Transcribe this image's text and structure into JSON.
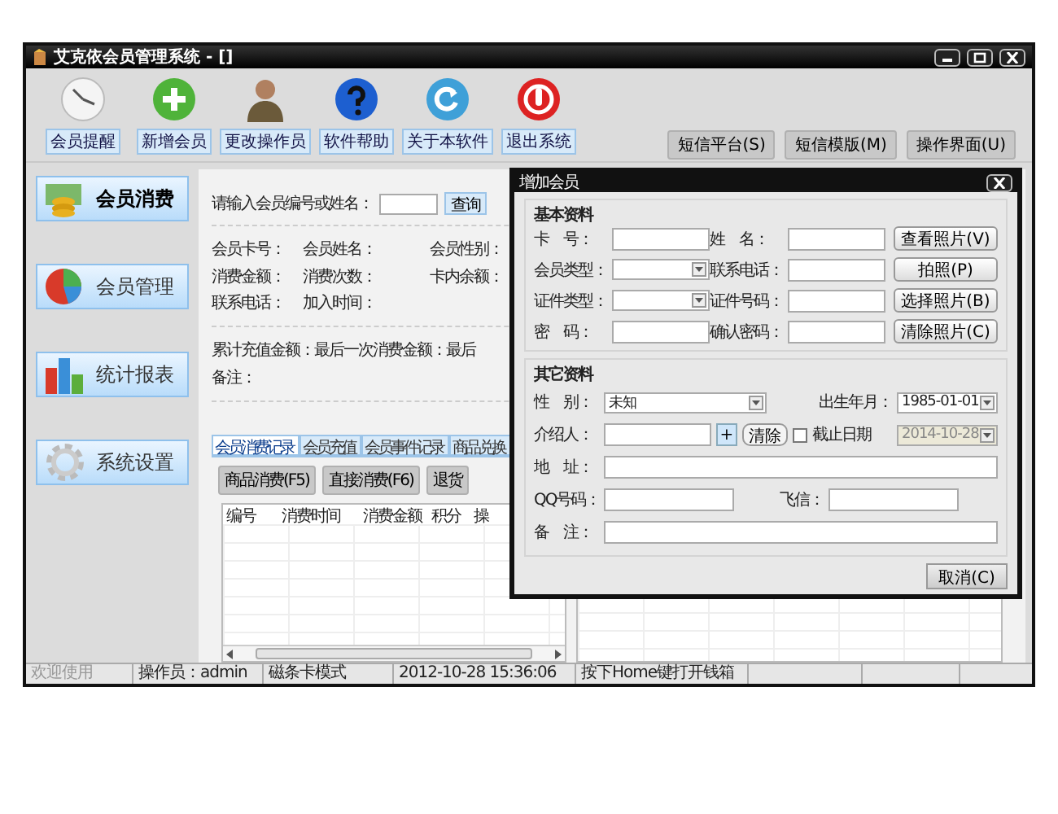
{
  "window": {
    "title": "艾克依会员管理系统 - []"
  },
  "toolbar": [
    {
      "label": "会员提醒",
      "kind": "clock"
    },
    {
      "label": "新增会员",
      "kind": "plus"
    },
    {
      "label": "更改操作员",
      "kind": "person"
    },
    {
      "label": "软件帮助",
      "kind": "help"
    },
    {
      "label": "关于本软件",
      "kind": "refresh"
    },
    {
      "label": "退出系统",
      "kind": "power"
    }
  ],
  "toolbar_buttons": [
    "短信平台(S)",
    "短信模版(M)",
    "操作界面(U)"
  ],
  "sidebar": [
    {
      "label": "会员消费",
      "selected": true,
      "kind": "coins"
    },
    {
      "label": "会员管理",
      "selected": false,
      "kind": "pie"
    },
    {
      "label": "统计报表",
      "selected": false,
      "kind": "bars"
    },
    {
      "label": "系统设置",
      "selected": false,
      "kind": "gear"
    }
  ],
  "search": {
    "label": "请输入会员编号或姓名：",
    "button": "查询"
  },
  "info_rows": [
    [
      "会员卡号：",
      "会员姓名：",
      "会员性别："
    ],
    [
      "消费金额：",
      "消费次数：",
      "卡内余额："
    ],
    [
      "联系电话：",
      "加入时间："
    ],
    [
      "累计充值金额：",
      "最后一次消费金额：",
      "最后"
    ],
    [
      "备注："
    ]
  ],
  "tabs": [
    {
      "label": "会员消费记录",
      "selected": true
    },
    {
      "label": "会员充值",
      "selected": false
    },
    {
      "label": "会员事件记录",
      "selected": false
    },
    {
      "label": "商品兑换",
      "selected": false
    }
  ],
  "action_buttons": [
    "商品消费(F5)",
    "直接消费(F6)",
    "退货"
  ],
  "table": {
    "columns": [
      "编号",
      "消费时间",
      "消费金额",
      "积分",
      "操"
    ]
  },
  "status_bar": [
    {
      "text": "欢迎使用",
      "disabled": true
    },
    {
      "text": "操作员：admin",
      "disabled": false
    },
    {
      "text": "磁条卡模式",
      "disabled": false
    },
    {
      "text": "2012-10-28 15:36:06",
      "disabled": false
    },
    {
      "text": "按下Home键打开钱箱",
      "disabled": false
    }
  ],
  "dialog": {
    "title": "增加会员",
    "basic": {
      "title": "基本资料",
      "fields": [
        {
          "label": "卡　号：",
          "kind": "text"
        },
        {
          "label": "姓　名：",
          "kind": "text"
        },
        {
          "label": "会员类型：",
          "kind": "combo"
        },
        {
          "label": "联系电话：",
          "kind": "text"
        },
        {
          "label": "证件类型：",
          "kind": "combo"
        },
        {
          "label": "证件号码：",
          "kind": "text"
        },
        {
          "label": "密　码：",
          "kind": "text"
        },
        {
          "label": "确认密码：",
          "kind": "text"
        }
      ],
      "photo_buttons": [
        "查看照片(V)",
        "拍照(P)",
        "选择照片(B)",
        "清除照片(C)"
      ]
    },
    "other": {
      "title": "其它资料",
      "gender": {
        "label": "性　别：",
        "value": "未知"
      },
      "birth": {
        "label": "出生年月：",
        "value": "1985-01-01"
      },
      "referrer": {
        "label": "介绍人：",
        "add": "+",
        "clear": "清除"
      },
      "expiry": {
        "label": "截止日期",
        "checked": false,
        "value": "2014-10-28",
        "disabled": true
      },
      "address": {
        "label": "地　址："
      },
      "qq": {
        "label": "QQ号码："
      },
      "fetion": {
        "label": "飞信："
      },
      "note": {
        "label": "备　注："
      }
    },
    "cancel": "取消(C)"
  }
}
